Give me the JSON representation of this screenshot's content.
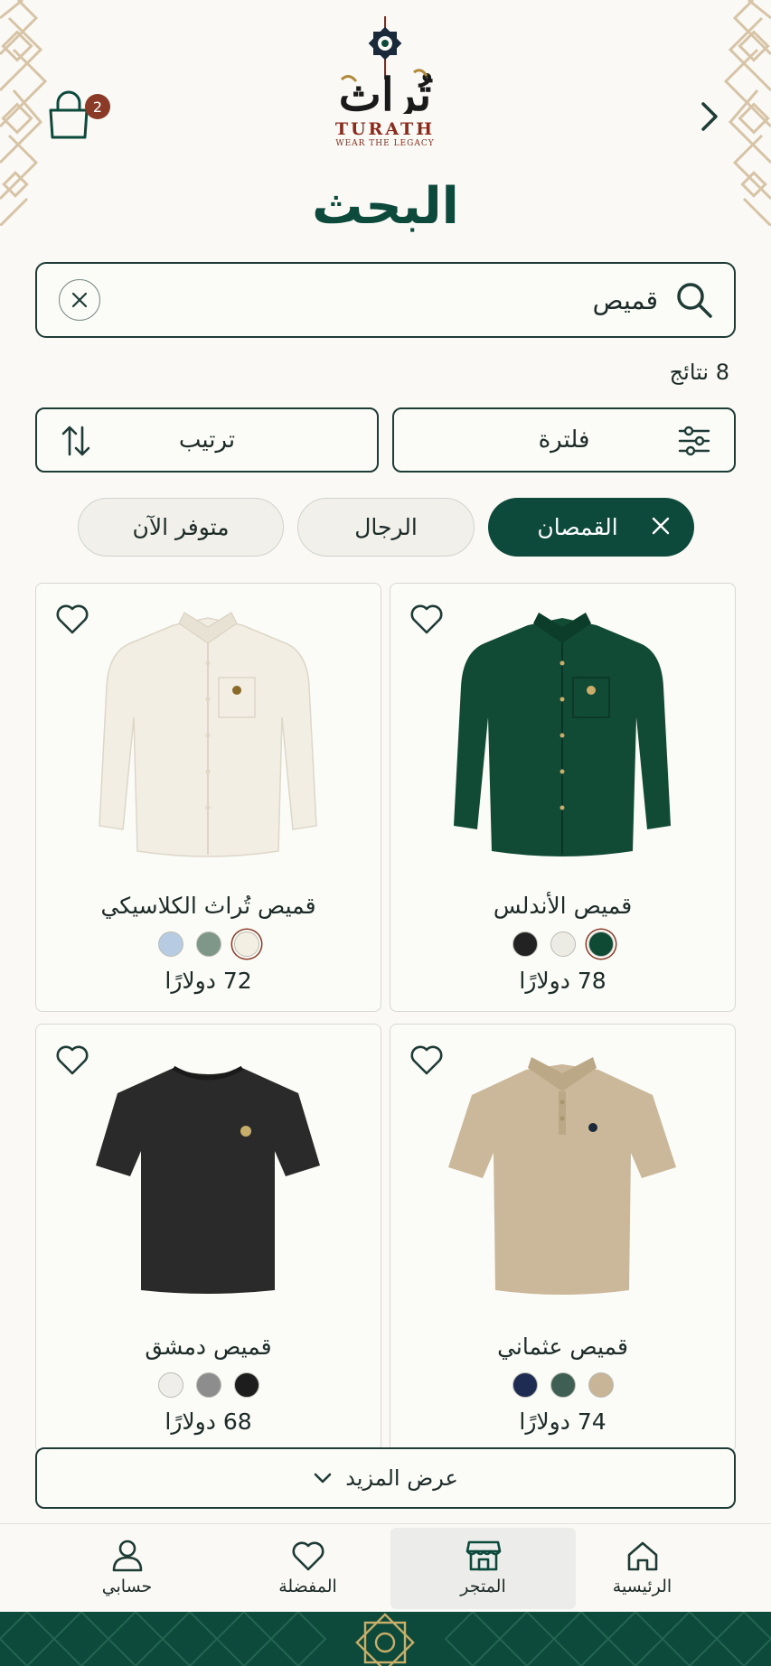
{
  "header": {
    "logo_text": "تُراث",
    "brand": "TURATH",
    "tagline": "WEAR THE LEGACY",
    "cart_count": "2"
  },
  "page_title": "البحث",
  "search": {
    "value": "قميص",
    "placeholder": ""
  },
  "results": {
    "count_label": "8 نتائج"
  },
  "controls": {
    "filter_label": "فلترة",
    "sort_label": "ترتيب"
  },
  "chips": [
    {
      "label": "القمصان",
      "active": true
    },
    {
      "label": "الرجال",
      "active": false
    },
    {
      "label": "متوفر الآن",
      "active": false
    }
  ],
  "products": [
    {
      "name": "قميص الأندلس",
      "price": "78 دولارًا",
      "swatches": [
        "#0f4a35",
        "#ecebe4",
        "#222222"
      ],
      "selected_swatch": 0
    },
    {
      "name": "قميص تُراث الكلاسيكي",
      "price": "72 دولارًا",
      "swatches": [
        "#f4efe3",
        "#7e9788",
        "#b7cce2"
      ],
      "selected_swatch": 0
    },
    {
      "name": "قميص عثماني",
      "price": "74 دولارًا",
      "swatches": [
        "#c8b497",
        "#3f5e54",
        "#1e2c54"
      ],
      "selected_swatch": null
    },
    {
      "name": "قميص دمشق",
      "price": "68 دولارًا",
      "swatches": [
        "#1d1d1d",
        "#8d8d8d",
        "#efeeea"
      ],
      "selected_swatch": null
    }
  ],
  "show_more_label": "عرض المزيد",
  "bottom_nav": [
    {
      "label": "الرئيسية",
      "icon": "home-icon",
      "active": false
    },
    {
      "label": "المتجر",
      "icon": "store-icon",
      "active": true
    },
    {
      "label": "المفضلة",
      "icon": "heart-icon",
      "active": false
    },
    {
      "label": "حسابي",
      "icon": "user-icon",
      "active": false
    }
  ],
  "colors": {
    "primary": "#0d4a3c",
    "accent": "#8a3a26",
    "background": "#faf9f5"
  }
}
